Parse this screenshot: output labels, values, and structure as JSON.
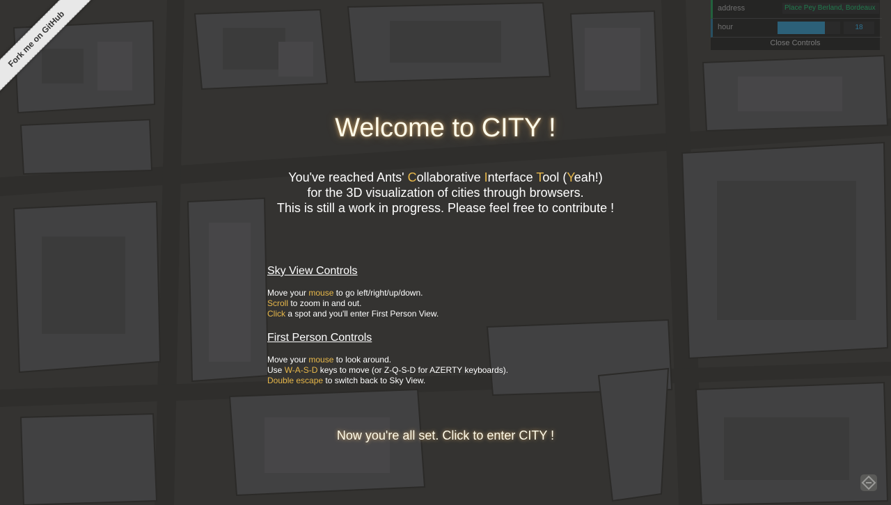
{
  "ribbon": {
    "label": "Fork me on GitHub"
  },
  "controls": {
    "address_label": "address",
    "address_value": "Place Pey Berland, Bordeaux",
    "hour_label": "hour",
    "hour_value": "18",
    "hour_level": 0.75,
    "close_label": "Close Controls",
    "address_color": "#1ed36f",
    "hour_color": "#2fa1d6"
  },
  "welcome": {
    "title": "Welcome to CITY !",
    "intro": {
      "p1": "You've reached Ants' ",
      "c": "C",
      "p2": "ollaborative ",
      "i": "I",
      "p3": "nterface ",
      "t": "T",
      "p4": "ool (",
      "y": "Y",
      "p5": "eah!)",
      "line2": "for the 3D visualization of cities through browsers.",
      "line3": "This is still a work in progress. Please feel free to contribute !"
    },
    "sky": {
      "heading": "Sky View Controls",
      "l1_pre": "Move your ",
      "l1_key": "mouse",
      "l1_post": " to go left/right/up/down.",
      "l2_key": "Scroll",
      "l2_post": " to zoom in and out.",
      "l3_key": "Click",
      "l3_post": " a spot and you'll enter First Person View."
    },
    "fp": {
      "heading": "First Person Controls",
      "l1_pre": "Move your ",
      "l1_key": "mouse",
      "l1_post": " to look around.",
      "l2_pre": "Use ",
      "l2_key": "W-A-S-D",
      "l2_post": " keys to move (or Z-Q-S-D for AZERTY keyboards).",
      "l3_key": "Double escape",
      "l3_post": " to switch back to Sky View."
    },
    "cta": "Now you're all set. Click to enter CITY !"
  },
  "colors": {
    "accent": "#e8b84a",
    "title": "#fffbe9"
  },
  "icons": {
    "corner": "app-logo-icon"
  }
}
